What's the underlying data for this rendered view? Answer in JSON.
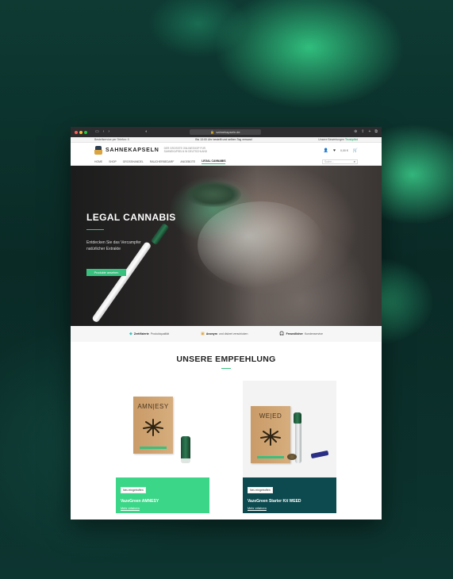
{
  "browser": {
    "url": "sahnekapseln.de"
  },
  "topbar": {
    "left": "Bestellservice per Telefon: 0",
    "middle": "Bis 13:00 Uhr bestellt und selben Tag versand",
    "right_text": "Unsere Bewertungen",
    "right_brand": "Trustpilot"
  },
  "header": {
    "logo": "SAHNEKAPSELN",
    "claim": "DER GROSSTE ONLINESHOP FÜR SAHNEKAPSELN IN DEUTSCHLAND",
    "cart_amount": "0,00 €"
  },
  "nav": {
    "items": [
      "HOME",
      "SHOP",
      "GROSSHANDEL",
      "RAUCHERBEDARF",
      "ANGEBOTE",
      "LEGAL CANNABIS"
    ],
    "search_placeholder": "Suche..."
  },
  "hero": {
    "title": "LEGAL CANNABIS",
    "text": "Entdecken Sie das Vercampfer natürlicher Extrakte",
    "button": "Produkte ansehen"
  },
  "usp": [
    {
      "bold": "Zertifizierte",
      "text": "Produktqualität",
      "icon": "diamond-icon"
    },
    {
      "bold": "Anonym",
      "text": "und diskret verschicken",
      "icon": "box-icon"
    },
    {
      "bold": "Freundlicher",
      "text": "Kundenservice",
      "icon": "headset-icon"
    }
  ],
  "recommendation": {
    "title": "UNSERE EMPFEHLUNG"
  },
  "products": [
    {
      "badge": "Neu eingetroffen",
      "name": "VazeGreen AMNESY",
      "box_label": "AMN|ESY",
      "more": "Mehr erfahren"
    },
    {
      "badge": "Neu eingetroffen",
      "name": "VazeGreen Starter Kit WEED",
      "box_label": "WE|ED",
      "more": "Mehr erfahren"
    }
  ],
  "colors": {
    "accent": "#39c07f",
    "card1": "#3bd687",
    "card2": "#0c4a4f"
  }
}
